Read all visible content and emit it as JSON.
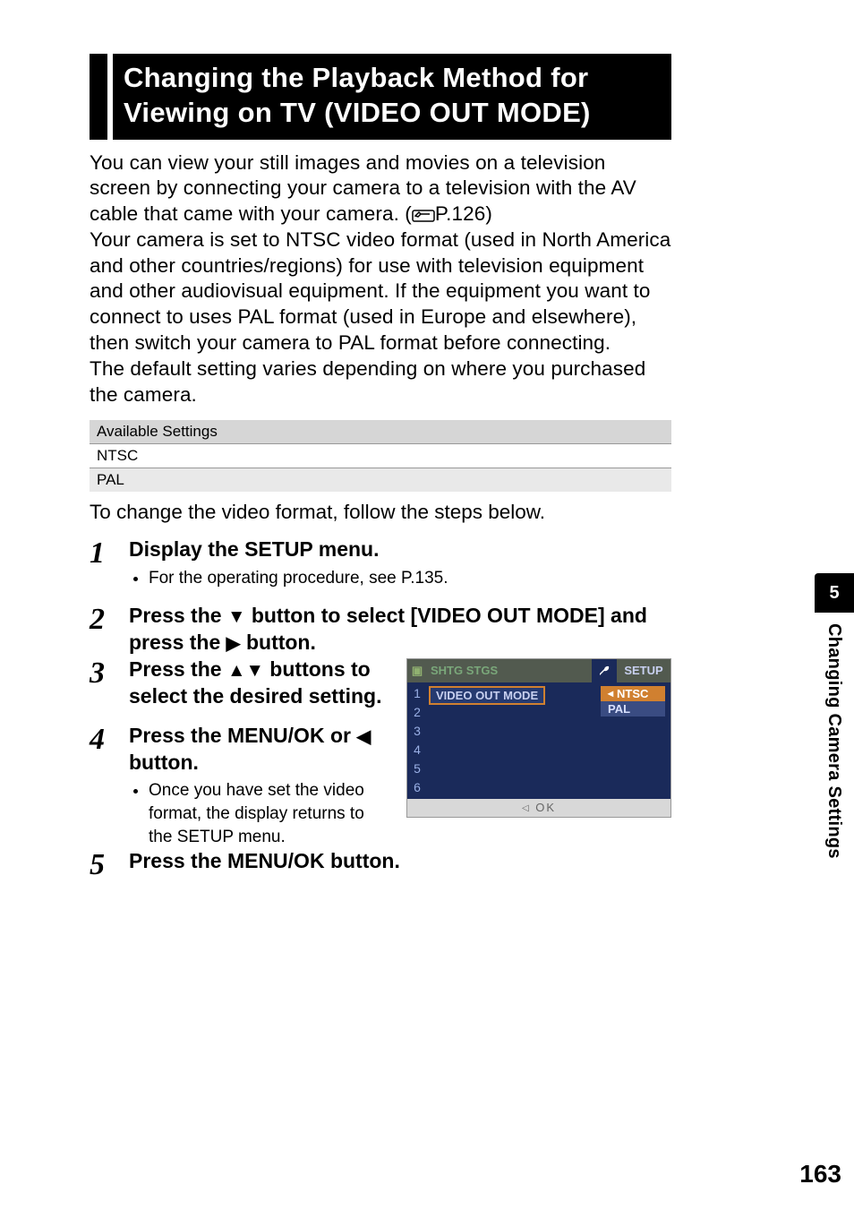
{
  "title": "Changing the Playback Method for Viewing on TV (VIDEO OUT MODE)",
  "intro": {
    "p1a": "You can view your still images and movies on a television screen by connecting your camera to a television with the AV cable that came with your camera. (",
    "p1_ref": "P.126",
    "p1b": ")",
    "p2": "Your camera is set to NTSC video format (used in North America and other countries/regions) for use with television equipment and other audiovisual equipment. If the equipment you want to connect to uses PAL format (used in Europe and elsewhere), then switch your camera to PAL format before connecting.",
    "p3": "The default setting varies depending on where you purchased the camera."
  },
  "table": {
    "header": "Available Settings",
    "row1": "NTSC",
    "row2": "PAL"
  },
  "lead": "To change the video format, follow the steps below.",
  "steps": {
    "s1": {
      "num": "1",
      "title": "Display the SETUP menu.",
      "sub": "For the operating procedure, see P.135."
    },
    "s2": {
      "num": "2",
      "title_a": "Press the ",
      "title_b": " button to select [VIDEO OUT MODE] and press the ",
      "title_c": " button."
    },
    "s3": {
      "num": "3",
      "title_a": "Press the ",
      "title_b": " buttons to select the desired setting."
    },
    "s4": {
      "num": "4",
      "title_a": "Press the MENU/OK or ",
      "title_b": " button.",
      "sub": "Once you have set the video format, the display returns to the SETUP menu."
    },
    "s5": {
      "num": "5",
      "title": "Press the MENU/OK button."
    }
  },
  "screenshot": {
    "tab1": "SHTG STGS",
    "setup": "SETUP",
    "row_label": "VIDEO OUT MODE",
    "opt1": "NTSC",
    "opt2": "PAL",
    "nums": [
      "1",
      "2",
      "3",
      "4",
      "5",
      "6"
    ],
    "footer": "OK"
  },
  "side": {
    "chapter": "5",
    "label": "Changing Camera Settings"
  },
  "page_number": "163"
}
